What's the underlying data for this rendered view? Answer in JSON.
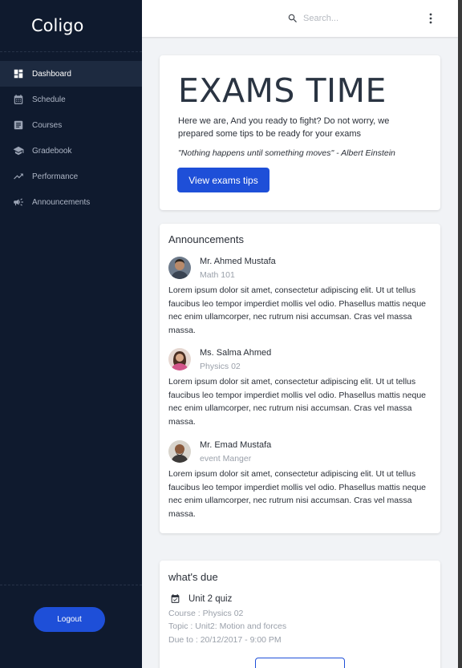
{
  "app": {
    "title": "Coligo"
  },
  "sidebar": {
    "items": [
      {
        "label": "Dashboard",
        "icon": "dashboard-icon",
        "active": true
      },
      {
        "label": "Schedule",
        "icon": "calendar-icon",
        "active": false
      },
      {
        "label": "Courses",
        "icon": "document-icon",
        "active": false
      },
      {
        "label": "Gradebook",
        "icon": "graduation-cap-icon",
        "active": false
      },
      {
        "label": "Performance",
        "icon": "trending-up-icon",
        "active": false
      },
      {
        "label": "Announcements",
        "icon": "megaphone-icon",
        "active": false
      }
    ],
    "logout_label": "Logout"
  },
  "topbar": {
    "search_placeholder": "Search..."
  },
  "exams": {
    "title": "EXAMS TIME",
    "text": "Here we are, And you ready to fight? Do not worry, we prepared some tips to be ready for your exams",
    "quote": "\"Nothing happens until something moves\" - Albert Einstein",
    "button_label": "View exams tips"
  },
  "announcements": {
    "title": "Announcements",
    "items": [
      {
        "name": "Mr. Ahmed Mustafa",
        "subtitle": "Math 101",
        "body": "Lorem ipsum dolor sit amet, consectetur adipiscing elit. Ut ut tellus faucibus leo tempor imperdiet mollis vel odio. Phasellus mattis neque nec enim ullamcorper, nec rutrum nisi accumsan. Cras vel massa massa."
      },
      {
        "name": "Ms. Salma Ahmed",
        "subtitle": "Physics 02",
        "body": "Lorem ipsum dolor sit amet, consectetur adipiscing elit. Ut ut tellus faucibus leo tempor imperdiet mollis vel odio. Phasellus mattis neque nec enim ullamcorper, nec rutrum nisi accumsan. Cras vel massa massa."
      },
      {
        "name": "Mr. Emad Mustafa",
        "subtitle": "event Manger",
        "body": "Lorem ipsum dolor sit amet, consectetur adipiscing elit. Ut ut tellus faucibus leo tempor imperdiet mollis vel odio. Phasellus mattis neque nec enim ullamcorper, nec rutrum nisi accumsan. Cras vel massa massa."
      }
    ]
  },
  "whats_due": {
    "title": "what's due",
    "items": [
      {
        "name": "Unit 2 quiz",
        "course": "Course : Physics 02",
        "topic": "Topic : Unit2: Motion and forces",
        "due": "Due to : 20/12/2017 - 9:00 PM"
      }
    ]
  },
  "colors": {
    "sidebar_bg": "#0f1a2e",
    "accent": "#1e4fd8",
    "main_bg": "#f1f3f6"
  }
}
